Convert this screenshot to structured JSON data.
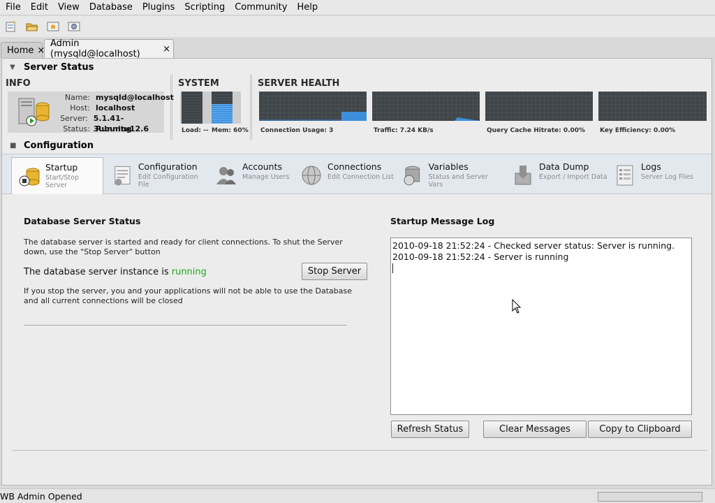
{
  "menubar": {
    "items": [
      "File",
      "Edit",
      "View",
      "Database",
      "Plugins",
      "Scripting",
      "Community",
      "Help"
    ]
  },
  "toolbar": {
    "buttons": [
      "new-model-icon",
      "open-model-icon",
      "new-query-icon",
      "manage-connections-icon"
    ]
  },
  "tabs": [
    {
      "label": "Home",
      "close": "×"
    },
    {
      "label": "Admin (mysqld@localhost)",
      "close": "×"
    }
  ],
  "server_status": {
    "title": "Server Status",
    "info": {
      "title": "INFO",
      "rows": [
        {
          "key": "Name:",
          "value": "mysqld@localhost"
        },
        {
          "key": "Host:",
          "value": "localhost"
        },
        {
          "key": "Server:",
          "value": "5.1.41-3ubuntu12.6"
        },
        {
          "key": "Status:",
          "value": "Running"
        }
      ]
    },
    "system": {
      "title": "SYSTEM",
      "load_label": "Load: --",
      "mem_label": "Mem: 60%",
      "mem_level": 0.6
    },
    "health": {
      "title": "SERVER HEALTH",
      "graphs": [
        {
          "label": "Connection Usage: 3"
        },
        {
          "label": "Traffic: 7.24 KB/s"
        },
        {
          "label": "Query Cache Hitrate: 0.00%"
        },
        {
          "label": "Key Efficiency: 0.00%"
        }
      ]
    }
  },
  "configuration": {
    "title": "Configuration",
    "tabs": [
      {
        "label": "Startup",
        "sub": "Start/Stop Server"
      },
      {
        "label": "Configuration",
        "sub": "Edit Configuration File"
      },
      {
        "label": "Accounts",
        "sub": "Manage Users"
      },
      {
        "label": "Connections",
        "sub": "Edit Connection List"
      },
      {
        "label": "Variables",
        "sub": "Status and Server Vars"
      },
      {
        "label": "Data Dump",
        "sub": "Export / Import Data"
      },
      {
        "label": "Logs",
        "sub": "Server Log Files"
      }
    ]
  },
  "startup": {
    "db_status_title": "Database Server Status",
    "description_line1": "The database server is started and ready for client connections. To shut the Server",
    "description_line2": "down, use the \"Stop Server\" button",
    "instance_prefix": "The database server instance is ",
    "instance_state": "running",
    "stop_button": "Stop Server",
    "warning_line1": "If you stop the server, you and your applications will not be able to use the Database",
    "warning_line2": "and all current connections will be closed",
    "log_title": "Startup Message Log",
    "log_lines": [
      "2010-09-18 21:52:24 - Checked server status: Server is running.",
      "2010-09-18 21:52:24 - Server is running"
    ],
    "refresh_button": "Refresh Status",
    "clear_button": "Clear Messages",
    "copy_button": "Copy to Clipboard"
  },
  "statusbar": {
    "text": "WB Admin Opened"
  },
  "colors": {
    "running": "#1fa81f",
    "graph_bg": "#404549",
    "graph_fill": "#3d8fdb"
  }
}
